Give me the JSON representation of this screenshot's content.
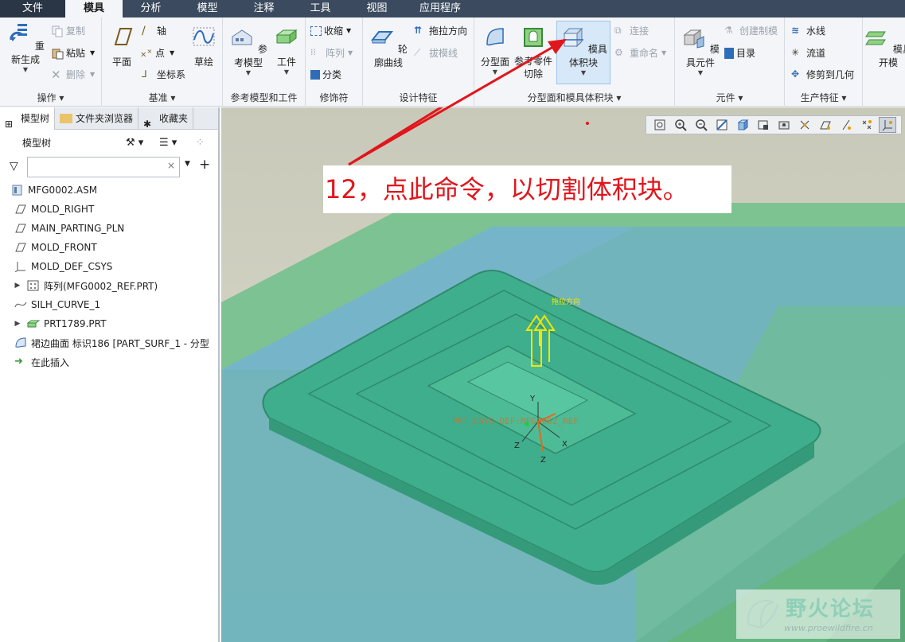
{
  "menu": {
    "tabs": [
      "文件",
      "模具",
      "分析",
      "模型",
      "注释",
      "工具",
      "视图",
      "应用程序"
    ],
    "active_index": 1
  },
  "ribbon": {
    "groups": {
      "operations": {
        "label": "操作",
        "regenerate": "重新生成",
        "copy": "复制",
        "paste": "粘贴",
        "delete": "删除"
      },
      "datum": {
        "label": "基准",
        "plane": "平面",
        "axis": "轴",
        "point": "点",
        "csys": "坐标系",
        "sketch": "草绘"
      },
      "ref_model": {
        "label": "参考模型和工件",
        "ref_model": "参考模型",
        "workpiece": "工件"
      },
      "modifiers": {
        "label": "修饰符",
        "shrink": "收缩",
        "pattern": "阵列",
        "classify": "分类"
      },
      "design_features": {
        "label": "设计特征",
        "silhouette": "轮廓曲线",
        "draw_direction": "拖拉方向",
        "draft_line": "拔模线"
      },
      "parting": {
        "label": "分型面和模具体积块",
        "parting_surface": "分型面",
        "ref_part_cutout": "参考零件切除",
        "mold_volume": "模具体积块",
        "connect": "连接",
        "rename": "重命名"
      },
      "components": {
        "label": "元件",
        "mold_component": "模具元件",
        "create_mold": "创建制模",
        "catalog": "目录"
      },
      "production": {
        "label": "生产特征",
        "waterline": "水线",
        "runner": "流道",
        "trim_to_geom": "修剪到几何"
      },
      "mold_open": {
        "mold_open": "模具开模"
      }
    }
  },
  "left_panel": {
    "tabs": [
      "模型树",
      "文件夹浏览器",
      "收藏夹"
    ],
    "header": "模型树",
    "filter_placeholder": "",
    "tree": [
      {
        "label": "MFG0002.ASM",
        "icon": "assembly-icon",
        "expandable": false
      },
      {
        "label": "MOLD_RIGHT",
        "icon": "datum-plane-icon",
        "expandable": false
      },
      {
        "label": "MAIN_PARTING_PLN",
        "icon": "datum-plane-icon",
        "expandable": false
      },
      {
        "label": "MOLD_FRONT",
        "icon": "datum-plane-icon",
        "expandable": false
      },
      {
        "label": "MOLD_DEF_CSYS",
        "icon": "csys-icon",
        "expandable": false
      },
      {
        "label": "阵列(MFG0002_REF.PRT)",
        "icon": "pattern-icon",
        "expandable": true
      },
      {
        "label": "SILH_CURVE_1",
        "icon": "curve-icon",
        "expandable": false
      },
      {
        "label": "PRT1789.PRT",
        "icon": "part-icon",
        "expandable": true
      },
      {
        "label": "裙边曲面 标识186 [PART_SURF_1 - 分型",
        "icon": "surface-icon",
        "expandable": false
      },
      {
        "label": "在此插入",
        "icon": "insert-arrow-icon",
        "expandable": false
      }
    ]
  },
  "viewport": {
    "annotation": "12，点此命令，以切割体积块。",
    "label_draw_direction": "拖拉方向",
    "csys_label": "PRT_CSYS_DEF:MFG0002_REF",
    "axis_x": "X",
    "axis_y": "Y",
    "axis_z": "Z",
    "watermark_title": "野火论坛",
    "watermark_url": "www.proewildfire.cn",
    "colors": {
      "annotation_red": "#e1161c",
      "part_green": "#3fae8c",
      "workpiece_blue": "#5d9fd6",
      "workpiece_green": "#5fbf8a"
    }
  }
}
